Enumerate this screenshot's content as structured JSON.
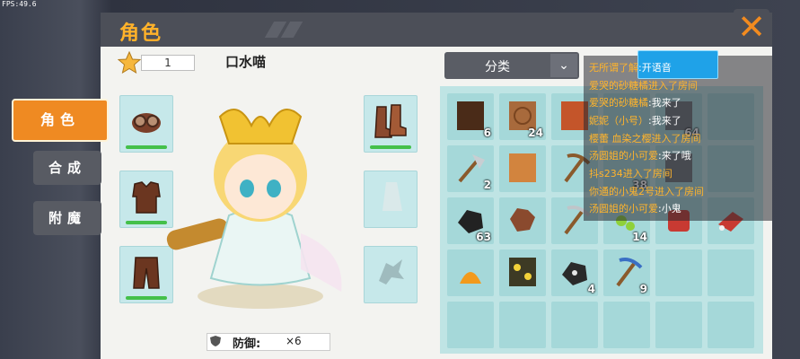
{
  "fps": "FPS:49.6",
  "header": {
    "title": "角色"
  },
  "nav": {
    "role": "角色",
    "craft": "合成",
    "enchant": "附魔"
  },
  "player": {
    "level": "1",
    "name": "口水喵"
  },
  "defense": {
    "label": "防御:",
    "value": "×6"
  },
  "category": {
    "label": "分类"
  },
  "inventory": {
    "counts": [
      "6",
      "24",
      "",
      "",
      "64",
      "",
      "2",
      "",
      "",
      "38",
      "63",
      "",
      "",
      "14",
      "",
      "",
      "4",
      "9",
      "",
      ""
    ]
  },
  "chat": [
    {
      "name": "无所谓了解",
      "sep": ":",
      "text": "开语音"
    },
    {
      "name": "爱哭的砂糖橘",
      "sep": "",
      "text": "进入了房间"
    },
    {
      "name": "爱哭的砂糖橘",
      "sep": ":",
      "text": "我来了"
    },
    {
      "name": "妮妮（小号）",
      "sep": ":",
      "text": "我来了"
    },
    {
      "name": "樱蕾 血染之樱",
      "sep": "",
      "text": "进入了房间"
    },
    {
      "name": "汤圆姐的小可爱",
      "sep": ":",
      "text": "来了哦"
    },
    {
      "name": "抖s234",
      "sep": "",
      "text": "进入了房间"
    },
    {
      "name": "你通的小鬼2号",
      "sep": "",
      "text": "进入了房间"
    },
    {
      "name": "汤圆姐的小可爱",
      "sep": ":",
      "text": "小鬼"
    }
  ],
  "colors": {
    "accent": "#ef8a22",
    "header": "#4c4f58",
    "slot": "#c6e8ea",
    "chat_name": "#ffb42c"
  }
}
